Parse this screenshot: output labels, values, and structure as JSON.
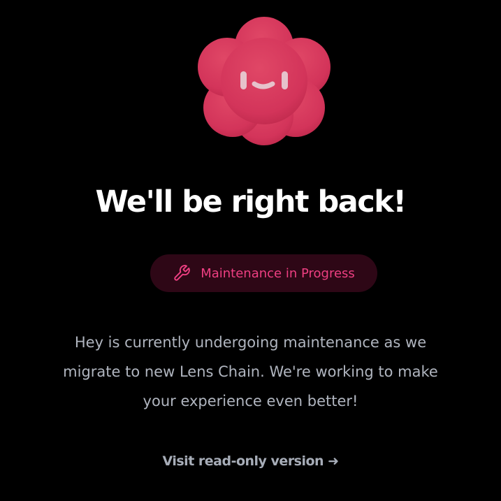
{
  "mascot": {
    "icon": "flower-mascot-icon",
    "color": "#d4355a"
  },
  "headline": "We'll be right back!",
  "badge": {
    "icon": "wrench-icon",
    "label": "Maintenance in Progress",
    "text_color": "#ee3f82",
    "background": "#2e0716"
  },
  "message": {
    "lines": [
      "Hey is currently undergoing maintenance as we",
      "migrate to new Lens Chain. We're working to make",
      "your experience even better!"
    ]
  },
  "link": {
    "label": "Visit read-only version",
    "arrow": "➜"
  }
}
